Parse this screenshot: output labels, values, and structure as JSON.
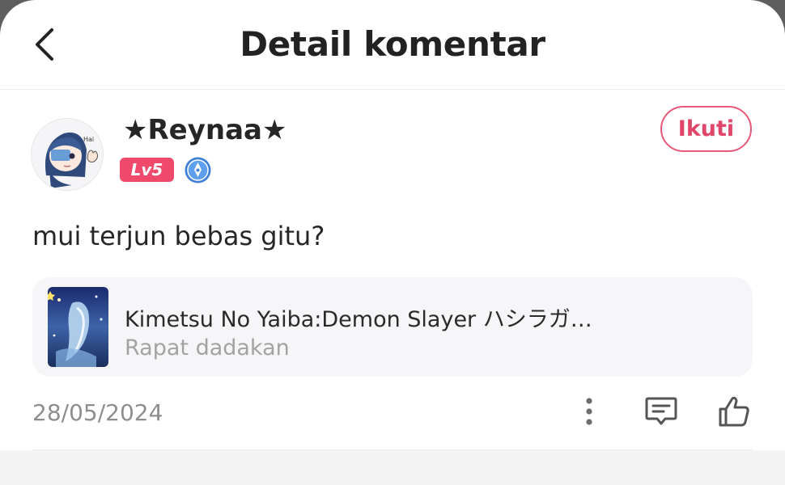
{
  "header": {
    "title": "Detail komentar",
    "back_icon": "chevron-left-icon"
  },
  "comment": {
    "username": "★Reynaa★",
    "level": "Lv5",
    "badge_icon": "pen-badge-icon",
    "follow_label": "Ikuti",
    "text": "mui terjun bebas gitu?",
    "date": "28/05/2024"
  },
  "linked_work": {
    "title": "Kimetsu No Yaiba:Demon Slayer ハシラガ…",
    "subtitle": "Rapat dadakan"
  },
  "actions": {
    "more_icon": "more-vertical-icon",
    "reply_icon": "comment-icon",
    "like_icon": "thumbs-up-icon"
  },
  "colors": {
    "accent": "#e0466a",
    "level_badge": "#ef4a6b",
    "card_bg": "#f6f6f8",
    "muted_text": "#8e8e8e"
  }
}
